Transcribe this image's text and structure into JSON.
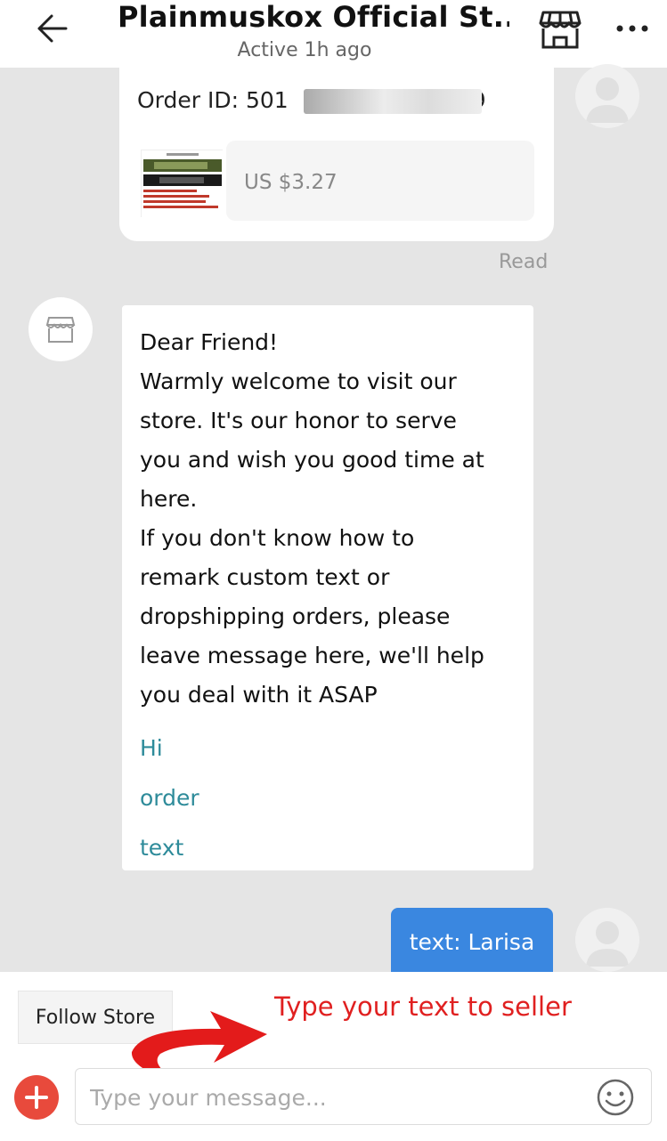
{
  "header": {
    "title": "Plainmuskox Official St...",
    "status": "Active 1h ago"
  },
  "order": {
    "id_label": "Order ID: 501",
    "id_tail": "9",
    "price": "US $3.27"
  },
  "read_status": "Read",
  "welcome": {
    "lines": [
      "Dear Friend!",
      "Warmly welcome to visit our",
      "store. It's our honor to serve",
      "you and wish you good time at",
      "here.",
      "If you don't know how to",
      "remark custom text or",
      "dropshipping orders, please",
      "leave message here, we'll help",
      "you deal with it ASAP"
    ],
    "quick_replies": [
      "Hi",
      "order",
      "text"
    ]
  },
  "sent_message": "text: Larisa",
  "bottom": {
    "follow_label": "Follow Store",
    "annotation": "Type your text to seller",
    "input_placeholder": "Type your message..."
  },
  "colors": {
    "accent_blue": "#3a87e0",
    "plus_red": "#e84a3c",
    "quick_reply": "#2e8b9a",
    "annotation_red": "#e02020"
  },
  "icons": [
    "back-arrow-icon",
    "store-icon",
    "more-icon",
    "avatar-icon",
    "plus-icon",
    "emoji-icon",
    "red-arrow-icon"
  ]
}
